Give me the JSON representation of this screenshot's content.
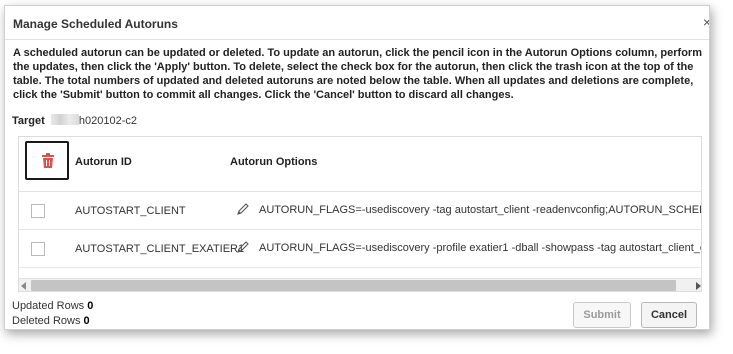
{
  "dialog": {
    "title": "Manage Scheduled Autoruns",
    "close_glyph": "×",
    "instructions": "A scheduled autorun can be updated or deleted. To update an autorun, click the pencil icon in the Autorun Options column, perform the updates, then click the 'Apply' button. To delete, select the check box for the autorun, then click the trash icon at the top of the table. The total numbers of updated and deleted autoruns are noted below the table. When all updates and deletions are complete, click the 'Submit' button to commit all changes. Click the 'Cancel' button to discard all changes."
  },
  "target": {
    "label": "Target",
    "value": "h020102-c2"
  },
  "table": {
    "columns": [
      "Autorun ID",
      "Autorun Options"
    ],
    "rows": [
      {
        "id": "AUTOSTART_CLIENT",
        "options": "AUTORUN_FLAGS=-usediscovery -tag autostart_client -readenvconfig;AUTORUN_SCHEDULE="
      },
      {
        "id": "AUTOSTART_CLIENT_EXATIER1",
        "options": "AUTORUN_FLAGS=-usediscovery -profile exatier1 -dball -showpass -tag autostart_client_exati"
      }
    ],
    "delete_icon": "trash-icon",
    "edit_icon": "pencil-icon"
  },
  "summary": {
    "updated_label": "Updated Rows",
    "updated_count": "0",
    "deleted_label": "Deleted Rows",
    "deleted_count": "0"
  },
  "buttons": {
    "submit": "Submit",
    "cancel": "Cancel"
  },
  "colors": {
    "trash": "#d9534f",
    "disabled_text": "#9a9a9a"
  }
}
